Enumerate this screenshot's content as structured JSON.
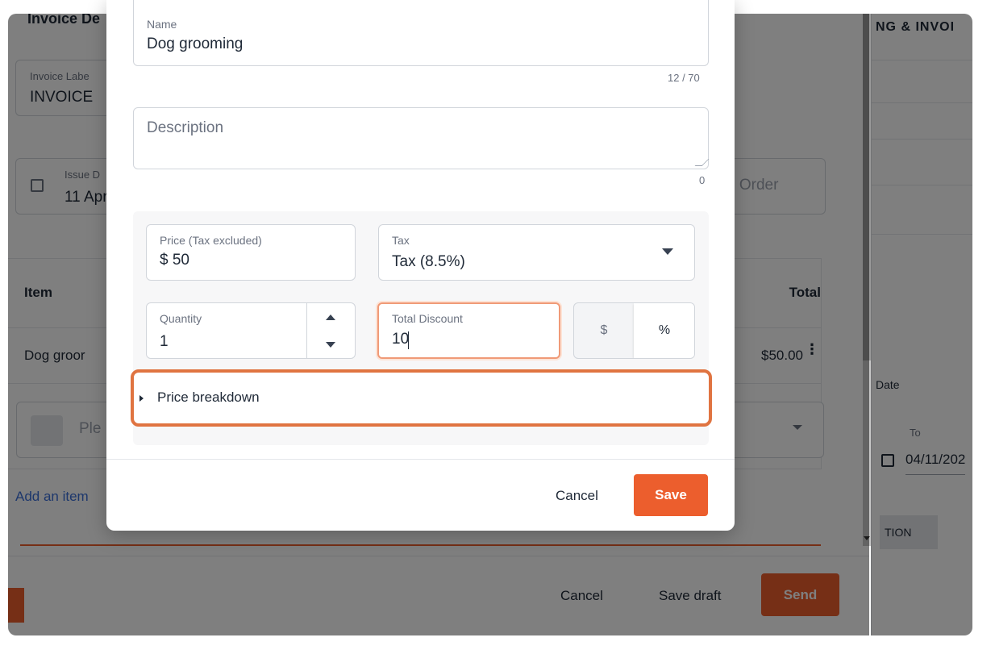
{
  "background": {
    "section_title": "Invoice De",
    "invoice_label_label": "Invoice Labe",
    "invoice_label_value": "INVOICE",
    "issue_date_label": "Issue D",
    "issue_date_value": "11 Apr",
    "purchase_order_placeholder": "e Order",
    "right_header": "NG & INVOI",
    "table_header_item": "Item",
    "table_header_total": "Total",
    "row_item": "Dog groor",
    "row_total": "$50.00",
    "select_placeholder": "Ple",
    "add_item_link": "Add an item",
    "right_date_label": "Date",
    "right_to_label": "To",
    "right_to_value": "04/11/202",
    "right_button_label": "TION",
    "footer_cancel": "Cancel",
    "footer_save_draft": "Save draft",
    "footer_send": "Send"
  },
  "modal": {
    "name_label": "Name",
    "name_value": "Dog grooming",
    "name_counter": "12 / 70",
    "description_placeholder": "Description",
    "description_counter": "0",
    "price_label": "Price (Tax excluded)",
    "price_value": "$ 50",
    "tax_label": "Tax",
    "tax_value": "Tax (8.5%)",
    "quantity_label": "Quantity",
    "quantity_value": "1",
    "discount_label": "Total Discount",
    "discount_value": "10",
    "discount_type_dollar": "$",
    "discount_type_percent": "%",
    "price_breakdown_label": "Price breakdown",
    "cancel_label": "Cancel",
    "save_label": "Save"
  },
  "colors": {
    "accent": "#ec5e2d",
    "highlight": "#e07441"
  }
}
